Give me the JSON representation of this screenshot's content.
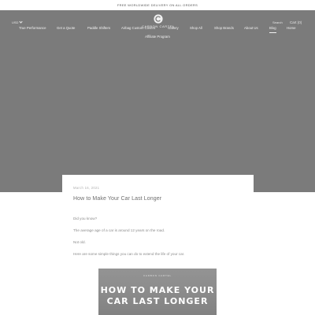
{
  "announcement": "FREE WORLDWIDE DELIVERY ON ALL ORDERS",
  "header": {
    "currency": "USD",
    "logo_text": "CARBON CARTEL",
    "logo_letter": "C",
    "search_label": "Search",
    "cart_label": "Cart (0)"
  },
  "nav": {
    "items": [
      {
        "label": "True Performance"
      },
      {
        "label": "Get a Quote"
      },
      {
        "label": "Paddle Shifters"
      },
      {
        "label": "Airbag Custom Covers"
      },
      {
        "label": "Gallery"
      },
      {
        "label": "Shop All"
      },
      {
        "label": "Shop Brands"
      },
      {
        "label": "About Us"
      },
      {
        "label": "Blog"
      },
      {
        "label": "Home"
      }
    ],
    "affiliate": "Affiliate Program",
    "active": "Blog"
  },
  "post": {
    "date": "March 16, 2021",
    "title": "How to Make Your Car Last Longer",
    "paragraphs": [
      "Did you know?",
      "The average age of a car is around 12 years on the road.",
      "Not old.",
      "Here are some simple things you can do to extend the life of your car."
    ]
  },
  "thumbnail": {
    "brand": "CARBON CARTEL",
    "line1": "HOW TO MAKE YOUR",
    "line2": "CAR LAST LONGER"
  },
  "colors": {
    "hero": "#7b7b7b",
    "text_muted": "#8c8c8c"
  }
}
